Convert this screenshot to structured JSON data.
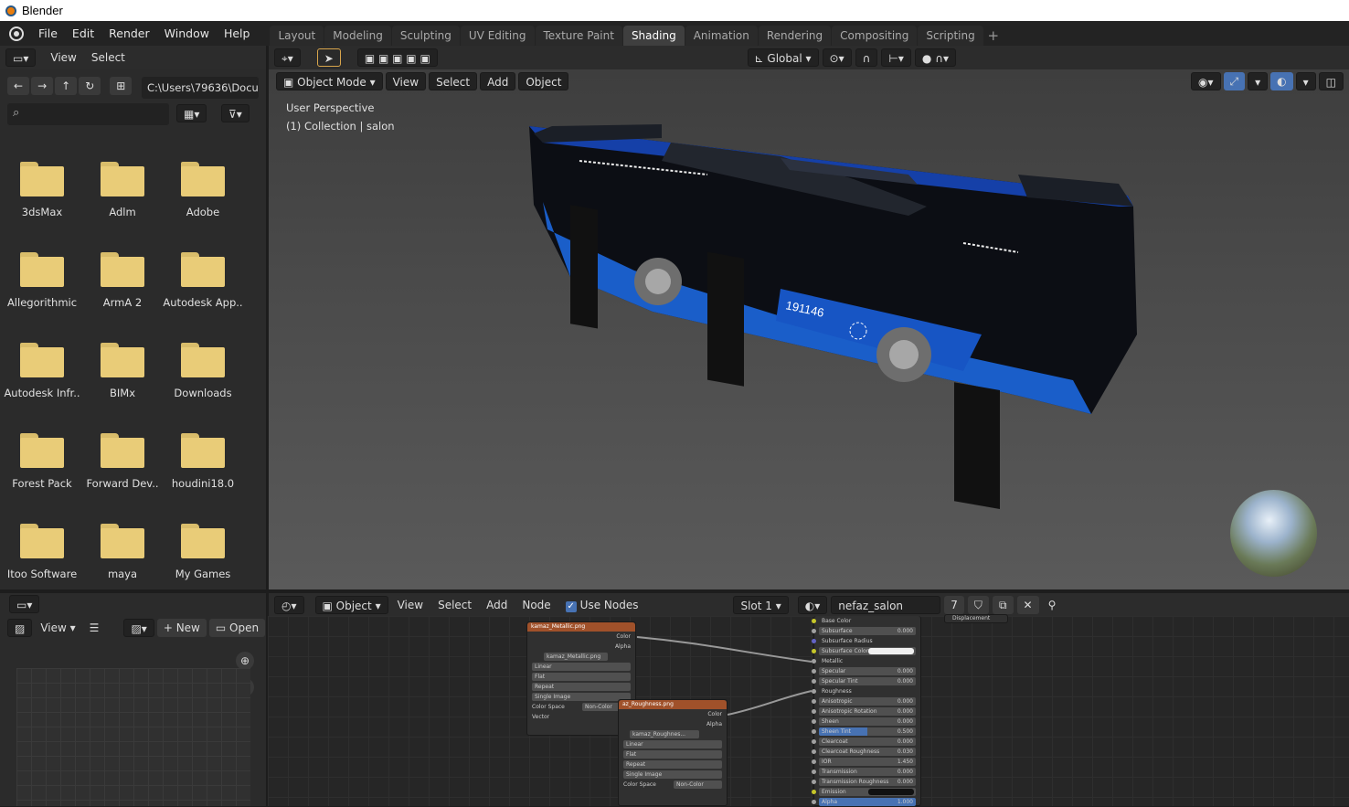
{
  "window": {
    "title": "Blender"
  },
  "menu": [
    "File",
    "Edit",
    "Render",
    "Window",
    "Help"
  ],
  "workspaces": [
    "Layout",
    "Modeling",
    "Sculpting",
    "UV Editing",
    "Texture Paint",
    "Shading",
    "Animation",
    "Rendering",
    "Compositing",
    "Scripting"
  ],
  "active_workspace": "Shading",
  "filebrowser": {
    "header": {
      "view": "View",
      "select": "Select"
    },
    "path": "C:\\Users\\79636\\Docu...",
    "search_placeholder": "",
    "folders": [
      "3dsMax",
      "Adlm",
      "Adobe",
      "Allegorithmic",
      "ArmA 2",
      "Autodesk App..",
      "Autodesk Infr..",
      "BIMx",
      "Downloads",
      "Forest Pack",
      "Forward Dev..",
      "houdini18.0",
      "Itoo Software",
      "maya",
      "My Games"
    ]
  },
  "viewport": {
    "top_header": {
      "transform": "Global"
    },
    "mode": "Object Mode",
    "menus": [
      "View",
      "Select",
      "Add",
      "Object"
    ],
    "overlay_title": "User Perspective",
    "overlay_collection": "(1) Collection | salon",
    "bus_number": "191146"
  },
  "image_editor": {
    "view": "View",
    "new": "New",
    "open": "Open"
  },
  "node_editor": {
    "object": "Object",
    "menus": [
      "View",
      "Select",
      "Add",
      "Node"
    ],
    "use_nodes": "Use Nodes",
    "slot": "Slot 1",
    "material": "nefaz_salon",
    "users": "7",
    "nodes": {
      "metallic": {
        "title": "kamaz_Metallic.png",
        "outputs": [
          "Color",
          "Alpha"
        ],
        "image": "kamaz_Metallic.png",
        "fields": [
          "Linear",
          "Flat",
          "Repeat",
          "Single Image"
        ],
        "colorspace_label": "Color Space",
        "colorspace": "Non-Color",
        "input": "Vector"
      },
      "roughness": {
        "title": "az_Roughness.png",
        "outputs": [
          "Color",
          "Alpha"
        ],
        "image": "kamaz_Roughnes...",
        "fields": [
          "Linear",
          "Flat",
          "Repeat",
          "Single Image"
        ],
        "colorspace_label": "Color Space",
        "colorspace": "Non-Color",
        "input": "Vector"
      },
      "bsdf": {
        "rows": [
          {
            "label": "Base Color",
            "value": ""
          },
          {
            "label": "Subsurface",
            "value": "0.000"
          },
          {
            "label": "Subsurface Radius",
            "value": ""
          },
          {
            "label": "Subsurface Color",
            "value": ""
          },
          {
            "label": "Metallic",
            "value": ""
          },
          {
            "label": "Specular",
            "value": "0.000"
          },
          {
            "label": "Specular Tint",
            "value": "0.000"
          },
          {
            "label": "Roughness",
            "value": ""
          },
          {
            "label": "Anisotropic",
            "value": "0.000"
          },
          {
            "label": "Anisotropic Rotation",
            "value": "0.000"
          },
          {
            "label": "Sheen",
            "value": "0.000"
          },
          {
            "label": "Sheen Tint",
            "value": "0.500"
          },
          {
            "label": "Clearcoat",
            "value": "0.000"
          },
          {
            "label": "Clearcoat Roughness",
            "value": "0.030"
          },
          {
            "label": "IOR",
            "value": "1.450"
          },
          {
            "label": "Transmission",
            "value": "0.000"
          },
          {
            "label": "Transmission Roughness",
            "value": "0.000"
          },
          {
            "label": "Emission",
            "value": ""
          },
          {
            "label": "Alpha",
            "value": "1.000"
          }
        ]
      },
      "output_partial": "Displacement"
    }
  }
}
